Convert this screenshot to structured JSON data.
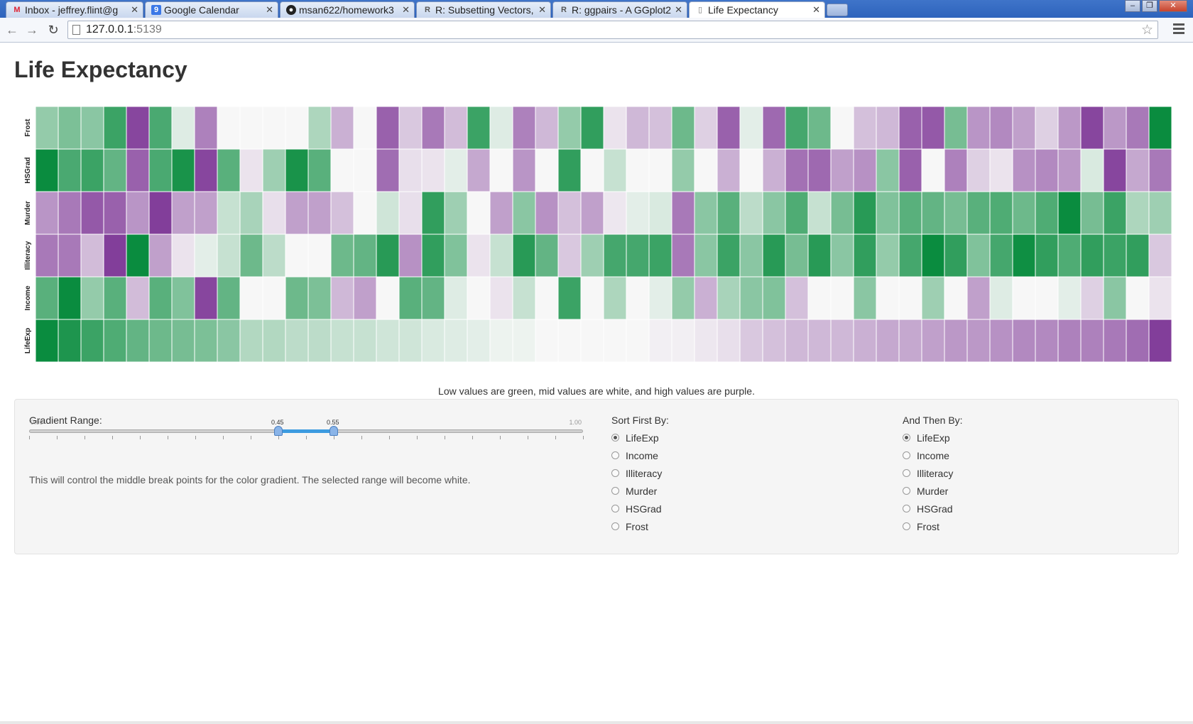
{
  "browser": {
    "tabs": [
      {
        "title": "Inbox - jeffrey.flint@g",
        "icon": "gmail-icon"
      },
      {
        "title": "Google Calendar",
        "icon": "calendar-icon"
      },
      {
        "title": "msan622/homework3",
        "icon": "github-icon"
      },
      {
        "title": "R: Subsetting Vectors,",
        "icon": "r-doc-icon"
      },
      {
        "title": "R: ggpairs - A GGplot2",
        "icon": "r-doc-icon"
      },
      {
        "title": "Life Expectancy",
        "icon": "page-icon"
      }
    ],
    "url_host": "127.0.0.1",
    "url_port": ":5139"
  },
  "page": {
    "title": "Life Expectancy",
    "caption": "Low values are green, mid values are white, and high values are purple."
  },
  "controls": {
    "gradient_label": "Gradient Range:",
    "slider_min_label": "0.00",
    "slider_max_label": "1.00",
    "slider_low": 0.45,
    "slider_high": 0.55,
    "slider_low_label": "0.45",
    "slider_high_label": "0.55",
    "help_text": "This will control the middle break points for the color gradient. The selected range will become white.",
    "sort_first_label": "Sort First By:",
    "then_by_label": "And Then By:",
    "options": [
      "LifeExp",
      "Income",
      "Illiteracy",
      "Murder",
      "HSGrad",
      "Frost"
    ],
    "sort_first_selected": "LifeExp",
    "then_by_selected": "LifeExp"
  },
  "chart_data": {
    "type": "heatmap",
    "rows": [
      "Frost",
      "HSGrad",
      "Murder",
      "Illiteracy",
      "Income",
      "LifeExp"
    ],
    "color_scale": {
      "low": "#008837",
      "mid": "#f7f7f7",
      "high": "#7b3294"
    },
    "values": [
      [
        0.3,
        0.25,
        0.28,
        0.12,
        0.95,
        0.15,
        0.45,
        0.8,
        0.5,
        0.5,
        0.5,
        0.5,
        0.35,
        0.68,
        0.5,
        0.88,
        0.62,
        0.82,
        0.65,
        0.12,
        0.45,
        0.8,
        0.66,
        0.3,
        0.1,
        0.55,
        0.66,
        0.64,
        0.22,
        0.6,
        0.88,
        0.46,
        0.86,
        0.14,
        0.22,
        0.5,
        0.64,
        0.66,
        0.88,
        0.9,
        0.24,
        0.75,
        0.78,
        0.72,
        0.6,
        0.74,
        0.95,
        0.74,
        0.82,
        0.02
      ],
      [
        0.02,
        0.15,
        0.12,
        0.2,
        0.88,
        0.15,
        0.05,
        0.95,
        0.18,
        0.55,
        0.32,
        0.05,
        0.18,
        0.5,
        0.5,
        0.85,
        0.56,
        0.55,
        0.46,
        0.7,
        0.5,
        0.75,
        0.5,
        0.1,
        0.5,
        0.4,
        0.5,
        0.5,
        0.3,
        0.5,
        0.68,
        0.5,
        0.68,
        0.84,
        0.86,
        0.72,
        0.76,
        0.28,
        0.88,
        0.5,
        0.8,
        0.6,
        0.55,
        0.76,
        0.78,
        0.74,
        0.44,
        0.95,
        0.7,
        0.82
      ],
      [
        0.75,
        0.82,
        0.9,
        0.88,
        0.75,
        0.97,
        0.72,
        0.72,
        0.4,
        0.34,
        0.56,
        0.72,
        0.72,
        0.64,
        0.5,
        0.42,
        0.56,
        0.1,
        0.32,
        0.5,
        0.72,
        0.28,
        0.76,
        0.64,
        0.72,
        0.54,
        0.46,
        0.44,
        0.82,
        0.28,
        0.18,
        0.38,
        0.28,
        0.16,
        0.4,
        0.24,
        0.08,
        0.26,
        0.18,
        0.2,
        0.24,
        0.18,
        0.16,
        0.22,
        0.16,
        0.02,
        0.24,
        0.12,
        0.35,
        0.32
      ],
      [
        0.82,
        0.82,
        0.65,
        0.97,
        0.02,
        0.72,
        0.55,
        0.46,
        0.4,
        0.22,
        0.38,
        0.5,
        0.5,
        0.22,
        0.2,
        0.08,
        0.76,
        0.1,
        0.26,
        0.55,
        0.4,
        0.08,
        0.2,
        0.62,
        0.32,
        0.14,
        0.14,
        0.12,
        0.82,
        0.28,
        0.12,
        0.28,
        0.08,
        0.24,
        0.08,
        0.28,
        0.1,
        0.3,
        0.14,
        0.02,
        0.1,
        0.26,
        0.14,
        0.03,
        0.1,
        0.16,
        0.1,
        0.12,
        0.1,
        0.62
      ],
      [
        0.18,
        0.02,
        0.3,
        0.18,
        0.65,
        0.18,
        0.26,
        0.95,
        0.2,
        0.5,
        0.5,
        0.22,
        0.25,
        0.66,
        0.72,
        0.5,
        0.18,
        0.2,
        0.45,
        0.5,
        0.55,
        0.4,
        0.5,
        0.12,
        0.5,
        0.35,
        0.5,
        0.46,
        0.3,
        0.68,
        0.34,
        0.28,
        0.26,
        0.64,
        0.5,
        0.5,
        0.28,
        0.5,
        0.5,
        0.32,
        0.5,
        0.72,
        0.45,
        0.5,
        0.5,
        0.46,
        0.6,
        0.28,
        0.5,
        0.55
      ],
      [
        0.02,
        0.06,
        0.12,
        0.16,
        0.2,
        0.22,
        0.24,
        0.25,
        0.28,
        0.36,
        0.36,
        0.38,
        0.38,
        0.4,
        0.4,
        0.42,
        0.42,
        0.44,
        0.45,
        0.46,
        0.48,
        0.48,
        0.5,
        0.5,
        0.5,
        0.5,
        0.5,
        0.52,
        0.52,
        0.54,
        0.56,
        0.62,
        0.64,
        0.66,
        0.66,
        0.66,
        0.68,
        0.7,
        0.7,
        0.72,
        0.74,
        0.74,
        0.76,
        0.78,
        0.78,
        0.8,
        0.8,
        0.82,
        0.85,
        0.97
      ]
    ]
  }
}
